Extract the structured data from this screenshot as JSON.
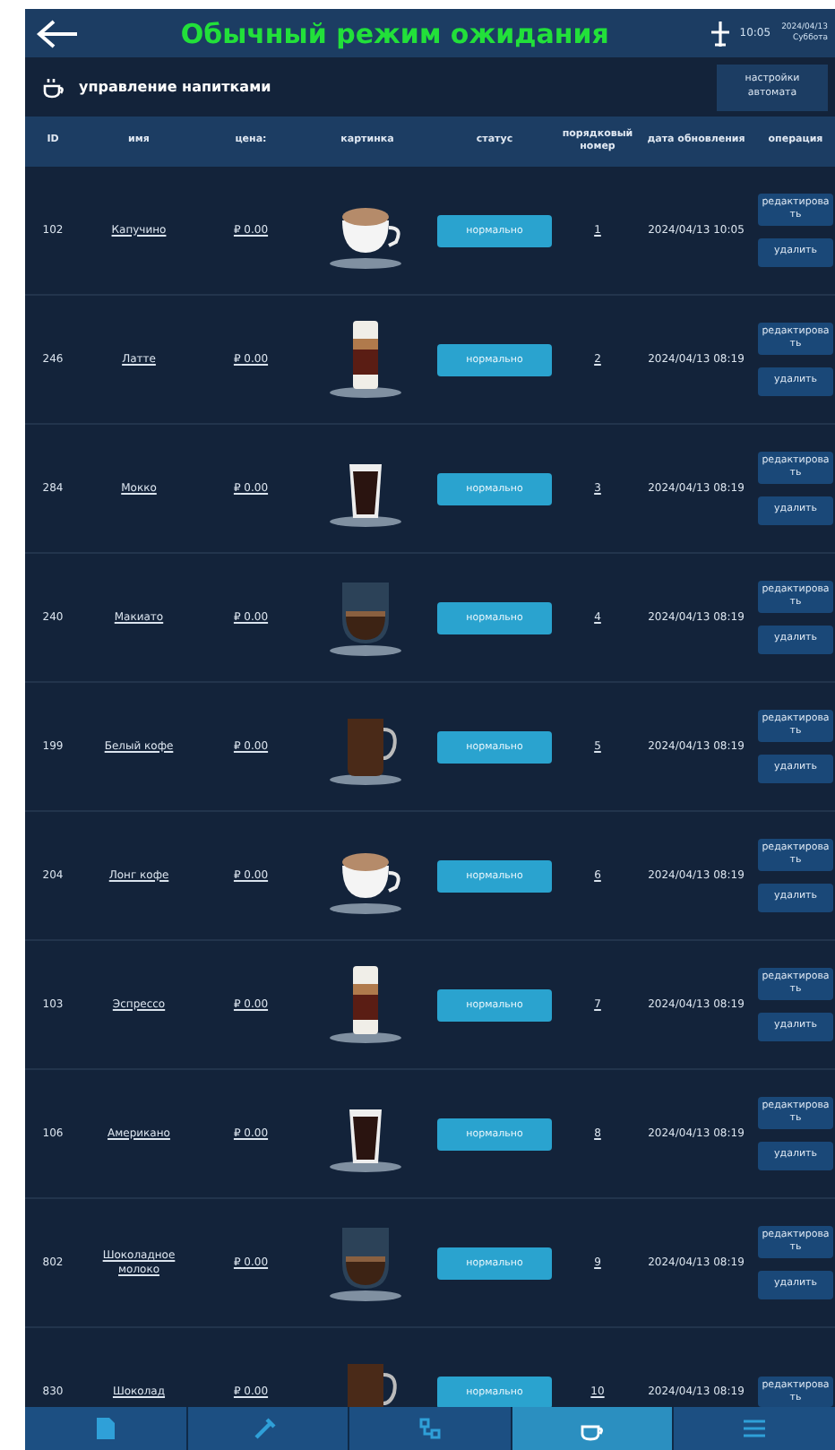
{
  "header": {
    "title": "Обычный режим ожидания",
    "time": "10:05",
    "date": "2024/04/13",
    "weekday": "Суббота"
  },
  "subheader": {
    "title": "управление напитками",
    "settings_button": "настройки автомата"
  },
  "table": {
    "columns": [
      "ID",
      "имя",
      "цена:",
      "картинка",
      "статус",
      "порядковый номер",
      "дата обновления",
      "операция"
    ],
    "rows": [
      {
        "id": "102",
        "name": "Капучино",
        "price": "₽ 0.00",
        "status": "нормально",
        "order": "1",
        "updated": "2024/04/13 10:05",
        "edit": "редактировать",
        "delete": "удалить"
      },
      {
        "id": "246",
        "name": "Латте",
        "price": "₽ 0.00",
        "status": "нормально",
        "order": "2",
        "updated": "2024/04/13 08:19",
        "edit": "редактировать",
        "delete": "удалить"
      },
      {
        "id": "284",
        "name": "Мокко",
        "price": "₽ 0.00",
        "status": "нормально",
        "order": "3",
        "updated": "2024/04/13 08:19",
        "edit": "редактировать",
        "delete": "удалить"
      },
      {
        "id": "240",
        "name": "Макиато",
        "price": "₽ 0.00",
        "status": "нормально",
        "order": "4",
        "updated": "2024/04/13 08:19",
        "edit": "редактировать",
        "delete": "удалить"
      },
      {
        "id": "199",
        "name": "Белый кофе",
        "price": "₽ 0.00",
        "status": "нормально",
        "order": "5",
        "updated": "2024/04/13 08:19",
        "edit": "редактировать",
        "delete": "удалить"
      },
      {
        "id": "204",
        "name": "Лонг кофе",
        "price": "₽ 0.00",
        "status": "нормально",
        "order": "6",
        "updated": "2024/04/13 08:19",
        "edit": "редактировать",
        "delete": "удалить"
      },
      {
        "id": "103",
        "name": "Эспрессо",
        "price": "₽ 0.00",
        "status": "нормально",
        "order": "7",
        "updated": "2024/04/13 08:19",
        "edit": "редактировать",
        "delete": "удалить"
      },
      {
        "id": "106",
        "name": "Американо",
        "price": "₽ 0.00",
        "status": "нормально",
        "order": "8",
        "updated": "2024/04/13 08:19",
        "edit": "редактировать",
        "delete": "удалить"
      },
      {
        "id": "802",
        "name": "Шоколадное молоко",
        "price": "₽ 0.00",
        "status": "нормально",
        "order": "9",
        "updated": "2024/04/13 08:19",
        "edit": "редактировать",
        "delete": "удалить"
      },
      {
        "id": "830",
        "name": "Шоколад",
        "price": "₽ 0.00",
        "status": "нормально",
        "order": "10",
        "updated": "2024/04/13 08:19",
        "edit": "редактировать"
      }
    ]
  },
  "bottom_nav": [
    {
      "selected": false
    },
    {
      "selected": false
    },
    {
      "selected": false
    },
    {
      "selected": true
    },
    {
      "selected": false
    }
  ]
}
